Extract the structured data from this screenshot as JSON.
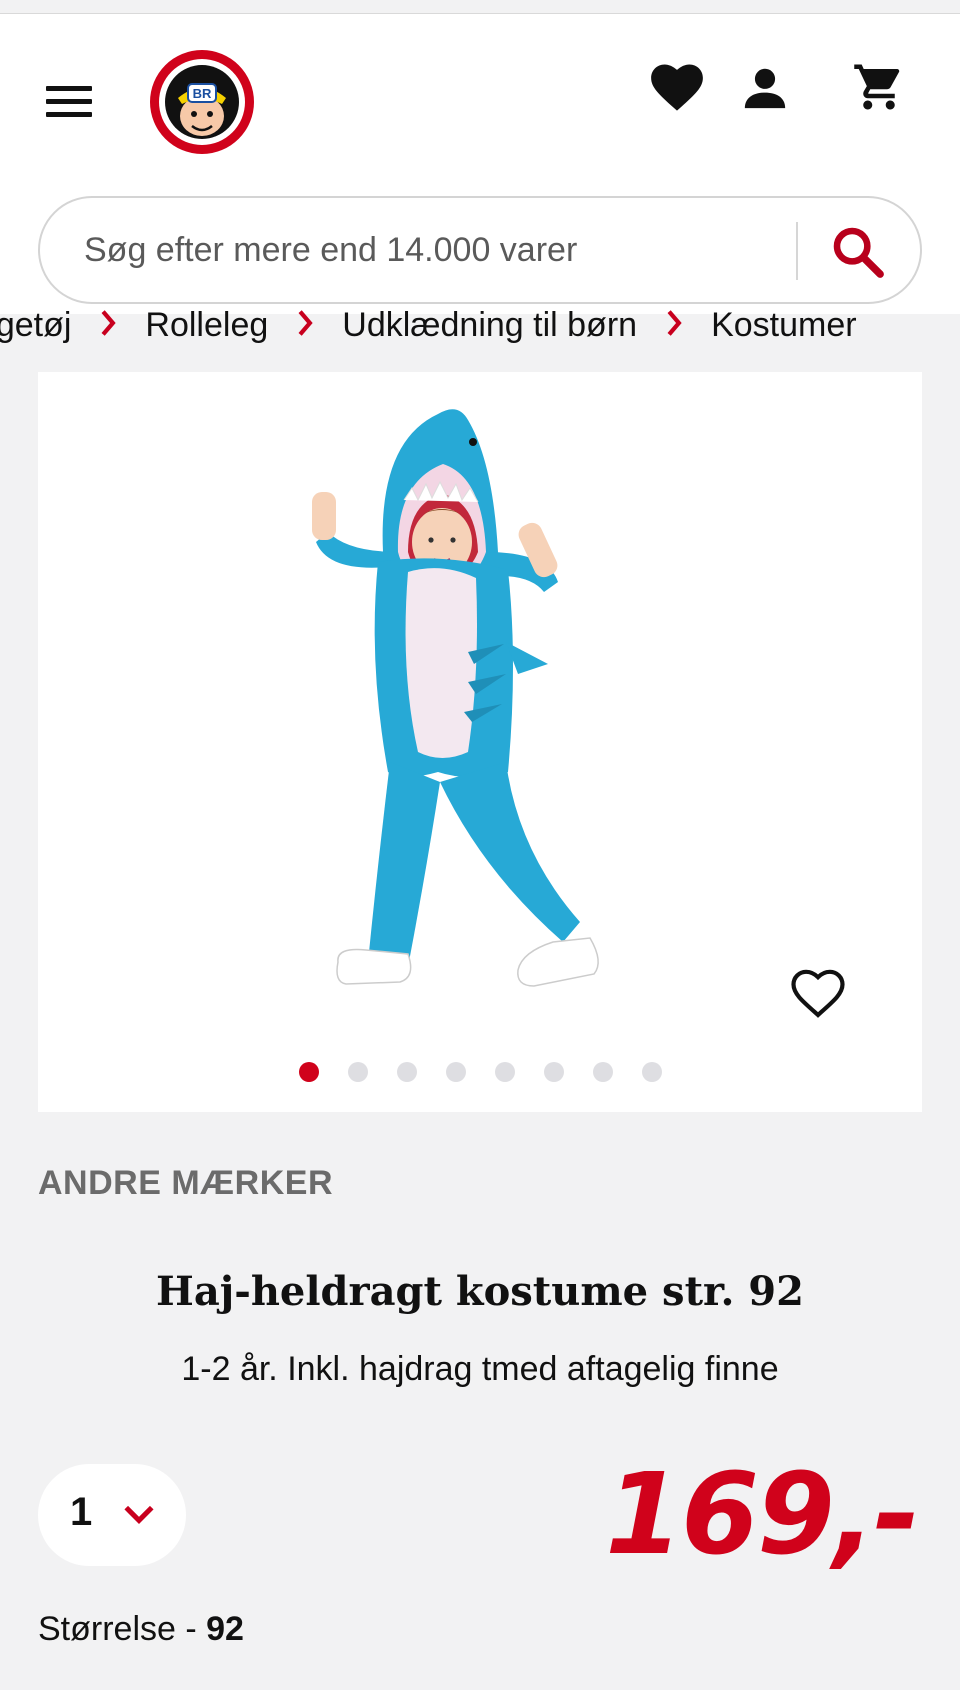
{
  "header": {
    "menu_icon": "hamburger-icon",
    "logo_text": "BR",
    "wishlist_icon": "heart-filled-icon",
    "account_icon": "person-icon",
    "cart_icon": "cart-icon"
  },
  "search": {
    "placeholder": "Søg efter mere end 14.000 varer",
    "icon": "search-icon"
  },
  "breadcrumb": [
    "Legetøj",
    "Rolleleg",
    "Udklædning til børn",
    "Kostumer"
  ],
  "gallery": {
    "image_count": 8,
    "active_index": 0,
    "wishlist_icon": "heart-outline-icon"
  },
  "product": {
    "brand": "ANDRE MÆRKER",
    "title": "Haj-heldragt kostume str. 92",
    "subtitle": "1-2 år. Inkl. hajdrag tmed aftagelig finne",
    "quantity": "1",
    "price": "169,-",
    "size_label": "Størrelse - ",
    "size_value": "92"
  },
  "colors": {
    "accent": "#d0021b",
    "background": "#f2f2f3",
    "costume_blue": "#27a9d6"
  }
}
